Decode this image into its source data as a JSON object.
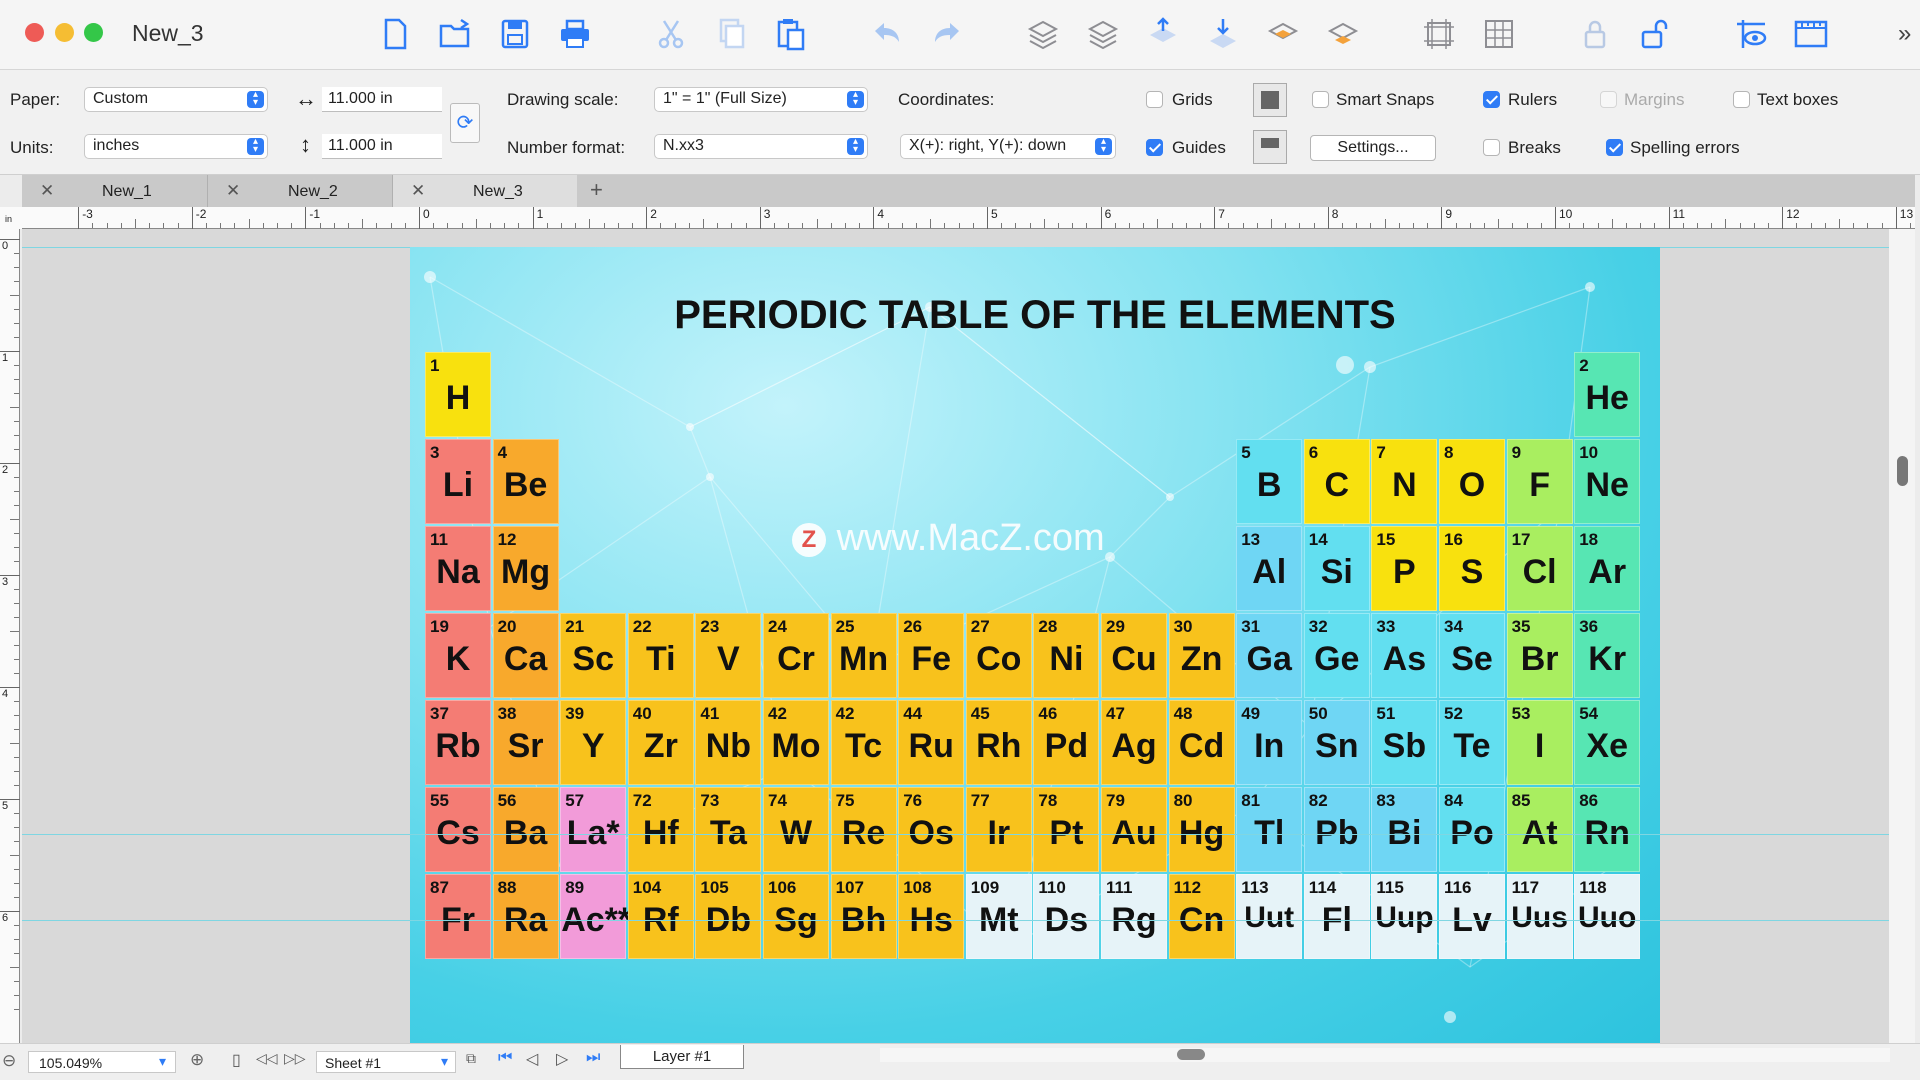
{
  "window": {
    "title": "New_3"
  },
  "options": {
    "paper_label": "Paper:",
    "paper_value": "Custom",
    "width_value": "11.000 in",
    "height_value": "11.000 in",
    "units_label": "Units:",
    "units_value": "inches",
    "scale_label": "Drawing scale:",
    "scale_value": "1\" = 1\"   (Full Size)",
    "numfmt_label": "Number format:",
    "numfmt_value": "N.xx3",
    "coords_label": "Coordinates:",
    "coords_value": "X(+): right, Y(+): down",
    "grids": "Grids",
    "guides": "Guides",
    "smart_snaps": "Smart Snaps",
    "settings": "Settings...",
    "rulers": "Rulers",
    "breaks": "Breaks",
    "margins": "Margins",
    "spelling": "Spelling errors",
    "textboxes": "Text boxes"
  },
  "tabs": [
    "New_1",
    "New_2",
    "New_3"
  ],
  "ruler": {
    "h": [
      "-3",
      "-2",
      "-1",
      "0",
      "1",
      "2",
      "3",
      "4",
      "5",
      "6",
      "7",
      "8",
      "9",
      "10",
      "11",
      "12",
      "13"
    ],
    "v": [
      "0",
      "1",
      "2",
      "3",
      "4",
      "5",
      "6"
    ],
    "unit": "in"
  },
  "document": {
    "title": "PERIODIC TABLE OF THE ELEMENTS",
    "watermark": "www.MacZ.com",
    "watermark_logo": "Z"
  },
  "colors": {
    "red": "#f47c74",
    "orange": "#f8a92c",
    "yellow_orange": "#f8c21c",
    "yellow": "#f8e10e",
    "pink": "#f29bd9",
    "lightblue": "#6fd6f4",
    "cyan": "#62dff0",
    "lime": "#a9ee60",
    "green": "#57e6b3",
    "white": "#e6f3f8"
  },
  "elements": [
    {
      "n": "1",
      "s": "H",
      "r": 0,
      "c": 0,
      "k": "yellow"
    },
    {
      "n": "2",
      "s": "He",
      "r": 0,
      "c": 17,
      "k": "green"
    },
    {
      "n": "3",
      "s": "Li",
      "r": 1,
      "c": 0,
      "k": "red"
    },
    {
      "n": "4",
      "s": "Be",
      "r": 1,
      "c": 1,
      "k": "orange"
    },
    {
      "n": "5",
      "s": "B",
      "r": 1,
      "c": 12,
      "k": "cyan"
    },
    {
      "n": "6",
      "s": "C",
      "r": 1,
      "c": 13,
      "k": "yellow"
    },
    {
      "n": "7",
      "s": "N",
      "r": 1,
      "c": 14,
      "k": "yellow"
    },
    {
      "n": "8",
      "s": "O",
      "r": 1,
      "c": 15,
      "k": "yellow"
    },
    {
      "n": "9",
      "s": "F",
      "r": 1,
      "c": 16,
      "k": "lime"
    },
    {
      "n": "10",
      "s": "Ne",
      "r": 1,
      "c": 17,
      "k": "green"
    },
    {
      "n": "11",
      "s": "Na",
      "r": 2,
      "c": 0,
      "k": "red"
    },
    {
      "n": "12",
      "s": "Mg",
      "r": 2,
      "c": 1,
      "k": "orange"
    },
    {
      "n": "13",
      "s": "Al",
      "r": 2,
      "c": 12,
      "k": "lightblue"
    },
    {
      "n": "14",
      "s": "Si",
      "r": 2,
      "c": 13,
      "k": "cyan"
    },
    {
      "n": "15",
      "s": "P",
      "r": 2,
      "c": 14,
      "k": "yellow"
    },
    {
      "n": "16",
      "s": "S",
      "r": 2,
      "c": 15,
      "k": "yellow"
    },
    {
      "n": "17",
      "s": "Cl",
      "r": 2,
      "c": 16,
      "k": "lime"
    },
    {
      "n": "18",
      "s": "Ar",
      "r": 2,
      "c": 17,
      "k": "green"
    },
    {
      "n": "19",
      "s": "K",
      "r": 3,
      "c": 0,
      "k": "red"
    },
    {
      "n": "20",
      "s": "Ca",
      "r": 3,
      "c": 1,
      "k": "orange"
    },
    {
      "n": "21",
      "s": "Sc",
      "r": 3,
      "c": 2,
      "k": "yellow_orange"
    },
    {
      "n": "22",
      "s": "Ti",
      "r": 3,
      "c": 3,
      "k": "yellow_orange"
    },
    {
      "n": "23",
      "s": "V",
      "r": 3,
      "c": 4,
      "k": "yellow_orange"
    },
    {
      "n": "24",
      "s": "Cr",
      "r": 3,
      "c": 5,
      "k": "yellow_orange"
    },
    {
      "n": "25",
      "s": "Mn",
      "r": 3,
      "c": 6,
      "k": "yellow_orange"
    },
    {
      "n": "26",
      "s": "Fe",
      "r": 3,
      "c": 7,
      "k": "yellow_orange"
    },
    {
      "n": "27",
      "s": "Co",
      "r": 3,
      "c": 8,
      "k": "yellow_orange"
    },
    {
      "n": "28",
      "s": "Ni",
      "r": 3,
      "c": 9,
      "k": "yellow_orange"
    },
    {
      "n": "29",
      "s": "Cu",
      "r": 3,
      "c": 10,
      "k": "yellow_orange"
    },
    {
      "n": "30",
      "s": "Zn",
      "r": 3,
      "c": 11,
      "k": "yellow_orange"
    },
    {
      "n": "31",
      "s": "Ga",
      "r": 3,
      "c": 12,
      "k": "lightblue"
    },
    {
      "n": "32",
      "s": "Ge",
      "r": 3,
      "c": 13,
      "k": "cyan"
    },
    {
      "n": "33",
      "s": "As",
      "r": 3,
      "c": 14,
      "k": "cyan"
    },
    {
      "n": "34",
      "s": "Se",
      "r": 3,
      "c": 15,
      "k": "cyan"
    },
    {
      "n": "35",
      "s": "Br",
      "r": 3,
      "c": 16,
      "k": "lime"
    },
    {
      "n": "36",
      "s": "Kr",
      "r": 3,
      "c": 17,
      "k": "green"
    },
    {
      "n": "37",
      "s": "Rb",
      "r": 4,
      "c": 0,
      "k": "red"
    },
    {
      "n": "38",
      "s": "Sr",
      "r": 4,
      "c": 1,
      "k": "orange"
    },
    {
      "n": "39",
      "s": "Y",
      "r": 4,
      "c": 2,
      "k": "yellow_orange"
    },
    {
      "n": "40",
      "s": "Zr",
      "r": 4,
      "c": 3,
      "k": "yellow_orange"
    },
    {
      "n": "41",
      "s": "Nb",
      "r": 4,
      "c": 4,
      "k": "yellow_orange"
    },
    {
      "n": "42",
      "s": "Mo",
      "r": 4,
      "c": 5,
      "k": "yellow_orange"
    },
    {
      "n": "42",
      "s": "Tc",
      "r": 4,
      "c": 6,
      "k": "yellow_orange"
    },
    {
      "n": "44",
      "s": "Ru",
      "r": 4,
      "c": 7,
      "k": "yellow_orange"
    },
    {
      "n": "45",
      "s": "Rh",
      "r": 4,
      "c": 8,
      "k": "yellow_orange"
    },
    {
      "n": "46",
      "s": "Pd",
      "r": 4,
      "c": 9,
      "k": "yellow_orange"
    },
    {
      "n": "47",
      "s": "Ag",
      "r": 4,
      "c": 10,
      "k": "yellow_orange"
    },
    {
      "n": "48",
      "s": "Cd",
      "r": 4,
      "c": 11,
      "k": "yellow_orange"
    },
    {
      "n": "49",
      "s": "In",
      "r": 4,
      "c": 12,
      "k": "lightblue"
    },
    {
      "n": "50",
      "s": "Sn",
      "r": 4,
      "c": 13,
      "k": "lightblue"
    },
    {
      "n": "51",
      "s": "Sb",
      "r": 4,
      "c": 14,
      "k": "cyan"
    },
    {
      "n": "52",
      "s": "Te",
      "r": 4,
      "c": 15,
      "k": "cyan"
    },
    {
      "n": "53",
      "s": "I",
      "r": 4,
      "c": 16,
      "k": "lime"
    },
    {
      "n": "54",
      "s": "Xe",
      "r": 4,
      "c": 17,
      "k": "green"
    },
    {
      "n": "55",
      "s": "Cs",
      "r": 5,
      "c": 0,
      "k": "red"
    },
    {
      "n": "56",
      "s": "Ba",
      "r": 5,
      "c": 1,
      "k": "orange"
    },
    {
      "n": "57",
      "s": "La*",
      "r": 5,
      "c": 2,
      "k": "pink"
    },
    {
      "n": "72",
      "s": "Hf",
      "r": 5,
      "c": 3,
      "k": "yellow_orange"
    },
    {
      "n": "73",
      "s": "Ta",
      "r": 5,
      "c": 4,
      "k": "yellow_orange"
    },
    {
      "n": "74",
      "s": "W",
      "r": 5,
      "c": 5,
      "k": "yellow_orange"
    },
    {
      "n": "75",
      "s": "Re",
      "r": 5,
      "c": 6,
      "k": "yellow_orange"
    },
    {
      "n": "76",
      "s": "Os",
      "r": 5,
      "c": 7,
      "k": "yellow_orange"
    },
    {
      "n": "77",
      "s": "Ir",
      "r": 5,
      "c": 8,
      "k": "yellow_orange"
    },
    {
      "n": "78",
      "s": "Pt",
      "r": 5,
      "c": 9,
      "k": "yellow_orange"
    },
    {
      "n": "79",
      "s": "Au",
      "r": 5,
      "c": 10,
      "k": "yellow_orange"
    },
    {
      "n": "80",
      "s": "Hg",
      "r": 5,
      "c": 11,
      "k": "yellow_orange"
    },
    {
      "n": "81",
      "s": "Tl",
      "r": 5,
      "c": 12,
      "k": "lightblue"
    },
    {
      "n": "82",
      "s": "Pb",
      "r": 5,
      "c": 13,
      "k": "lightblue"
    },
    {
      "n": "83",
      "s": "Bi",
      "r": 5,
      "c": 14,
      "k": "lightblue"
    },
    {
      "n": "84",
      "s": "Po",
      "r": 5,
      "c": 15,
      "k": "cyan"
    },
    {
      "n": "85",
      "s": "At",
      "r": 5,
      "c": 16,
      "k": "lime"
    },
    {
      "n": "86",
      "s": "Rn",
      "r": 5,
      "c": 17,
      "k": "green"
    },
    {
      "n": "87",
      "s": "Fr",
      "r": 6,
      "c": 0,
      "k": "red"
    },
    {
      "n": "88",
      "s": "Ra",
      "r": 6,
      "c": 1,
      "k": "orange"
    },
    {
      "n": "89",
      "s": "Ac**",
      "r": 6,
      "c": 2,
      "k": "pink"
    },
    {
      "n": "104",
      "s": "Rf",
      "r": 6,
      "c": 3,
      "k": "yellow_orange"
    },
    {
      "n": "105",
      "s": "Db",
      "r": 6,
      "c": 4,
      "k": "yellow_orange"
    },
    {
      "n": "106",
      "s": "Sg",
      "r": 6,
      "c": 5,
      "k": "yellow_orange"
    },
    {
      "n": "107",
      "s": "Bh",
      "r": 6,
      "c": 6,
      "k": "yellow_orange"
    },
    {
      "n": "108",
      "s": "Hs",
      "r": 6,
      "c": 7,
      "k": "yellow_orange"
    },
    {
      "n": "109",
      "s": "Mt",
      "r": 6,
      "c": 8,
      "k": "white"
    },
    {
      "n": "110",
      "s": "Ds",
      "r": 6,
      "c": 9,
      "k": "white"
    },
    {
      "n": "111",
      "s": "Rg",
      "r": 6,
      "c": 10,
      "k": "white"
    },
    {
      "n": "112",
      "s": "Cn",
      "r": 6,
      "c": 11,
      "k": "yellow_orange"
    },
    {
      "n": "113",
      "s": "Uut",
      "r": 6,
      "c": 12,
      "k": "white"
    },
    {
      "n": "114",
      "s": "Fl",
      "r": 6,
      "c": 13,
      "k": "white"
    },
    {
      "n": "115",
      "s": "Uup",
      "r": 6,
      "c": 14,
      "k": "white"
    },
    {
      "n": "116",
      "s": "Lv",
      "r": 6,
      "c": 15,
      "k": "white"
    },
    {
      "n": "117",
      "s": "Uus",
      "r": 6,
      "c": 16,
      "k": "white"
    },
    {
      "n": "118",
      "s": "Uuo",
      "r": 6,
      "c": 17,
      "k": "white"
    }
  ],
  "statusbar": {
    "zoom": "105.049%",
    "sheet": "Sheet #1",
    "layer": "Layer #1"
  }
}
